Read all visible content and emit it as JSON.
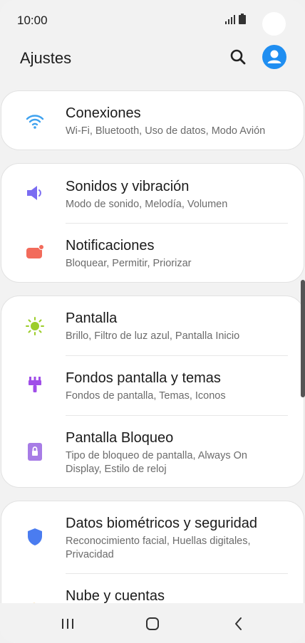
{
  "status": {
    "time": "10:00"
  },
  "header": {
    "title": "Ajustes"
  },
  "colors": {
    "accent": "#1f8ef1",
    "wifi": "#3fa2ef",
    "sound": "#7a6cf2",
    "notif": "#f26b5b",
    "display": "#9ccd2a",
    "wallpaper": "#a04ee8",
    "lock": "#a77ce6",
    "security": "#4a7cf0",
    "cloud": "#f2b03a"
  },
  "cards": [
    {
      "items": [
        {
          "icon": "wifi-icon",
          "title": "Conexiones",
          "subtitle": "Wi-Fi, Bluetooth, Uso de datos, Modo Avión"
        }
      ]
    },
    {
      "items": [
        {
          "icon": "volume-icon",
          "title": "Sonidos y vibración",
          "subtitle": "Modo de sonido, Melodía, Volumen"
        },
        {
          "icon": "notification-icon",
          "title": "Notificaciones",
          "subtitle": "Bloquear, Permitir, Priorizar"
        }
      ]
    },
    {
      "items": [
        {
          "icon": "sun-icon",
          "title": "Pantalla",
          "subtitle": "Brillo, Filtro de luz azul, Pantalla Inicio"
        },
        {
          "icon": "paintbrush-icon",
          "title": "Fondos pantalla y temas",
          "subtitle": "Fondos de pantalla, Temas, Iconos"
        },
        {
          "icon": "lock-icon",
          "title": "Pantalla Bloqueo",
          "subtitle": "Tipo de bloqueo de pantalla, Always On Display, Estilo de reloj"
        }
      ]
    },
    {
      "items": [
        {
          "icon": "shield-icon",
          "title": "Datos biométricos y seguridad",
          "subtitle": "Reconocimiento facial, Huellas digitales, Privacidad"
        },
        {
          "icon": "cloud-key-icon",
          "title": "Nube y cuentas",
          "subtitle": ""
        }
      ]
    }
  ]
}
